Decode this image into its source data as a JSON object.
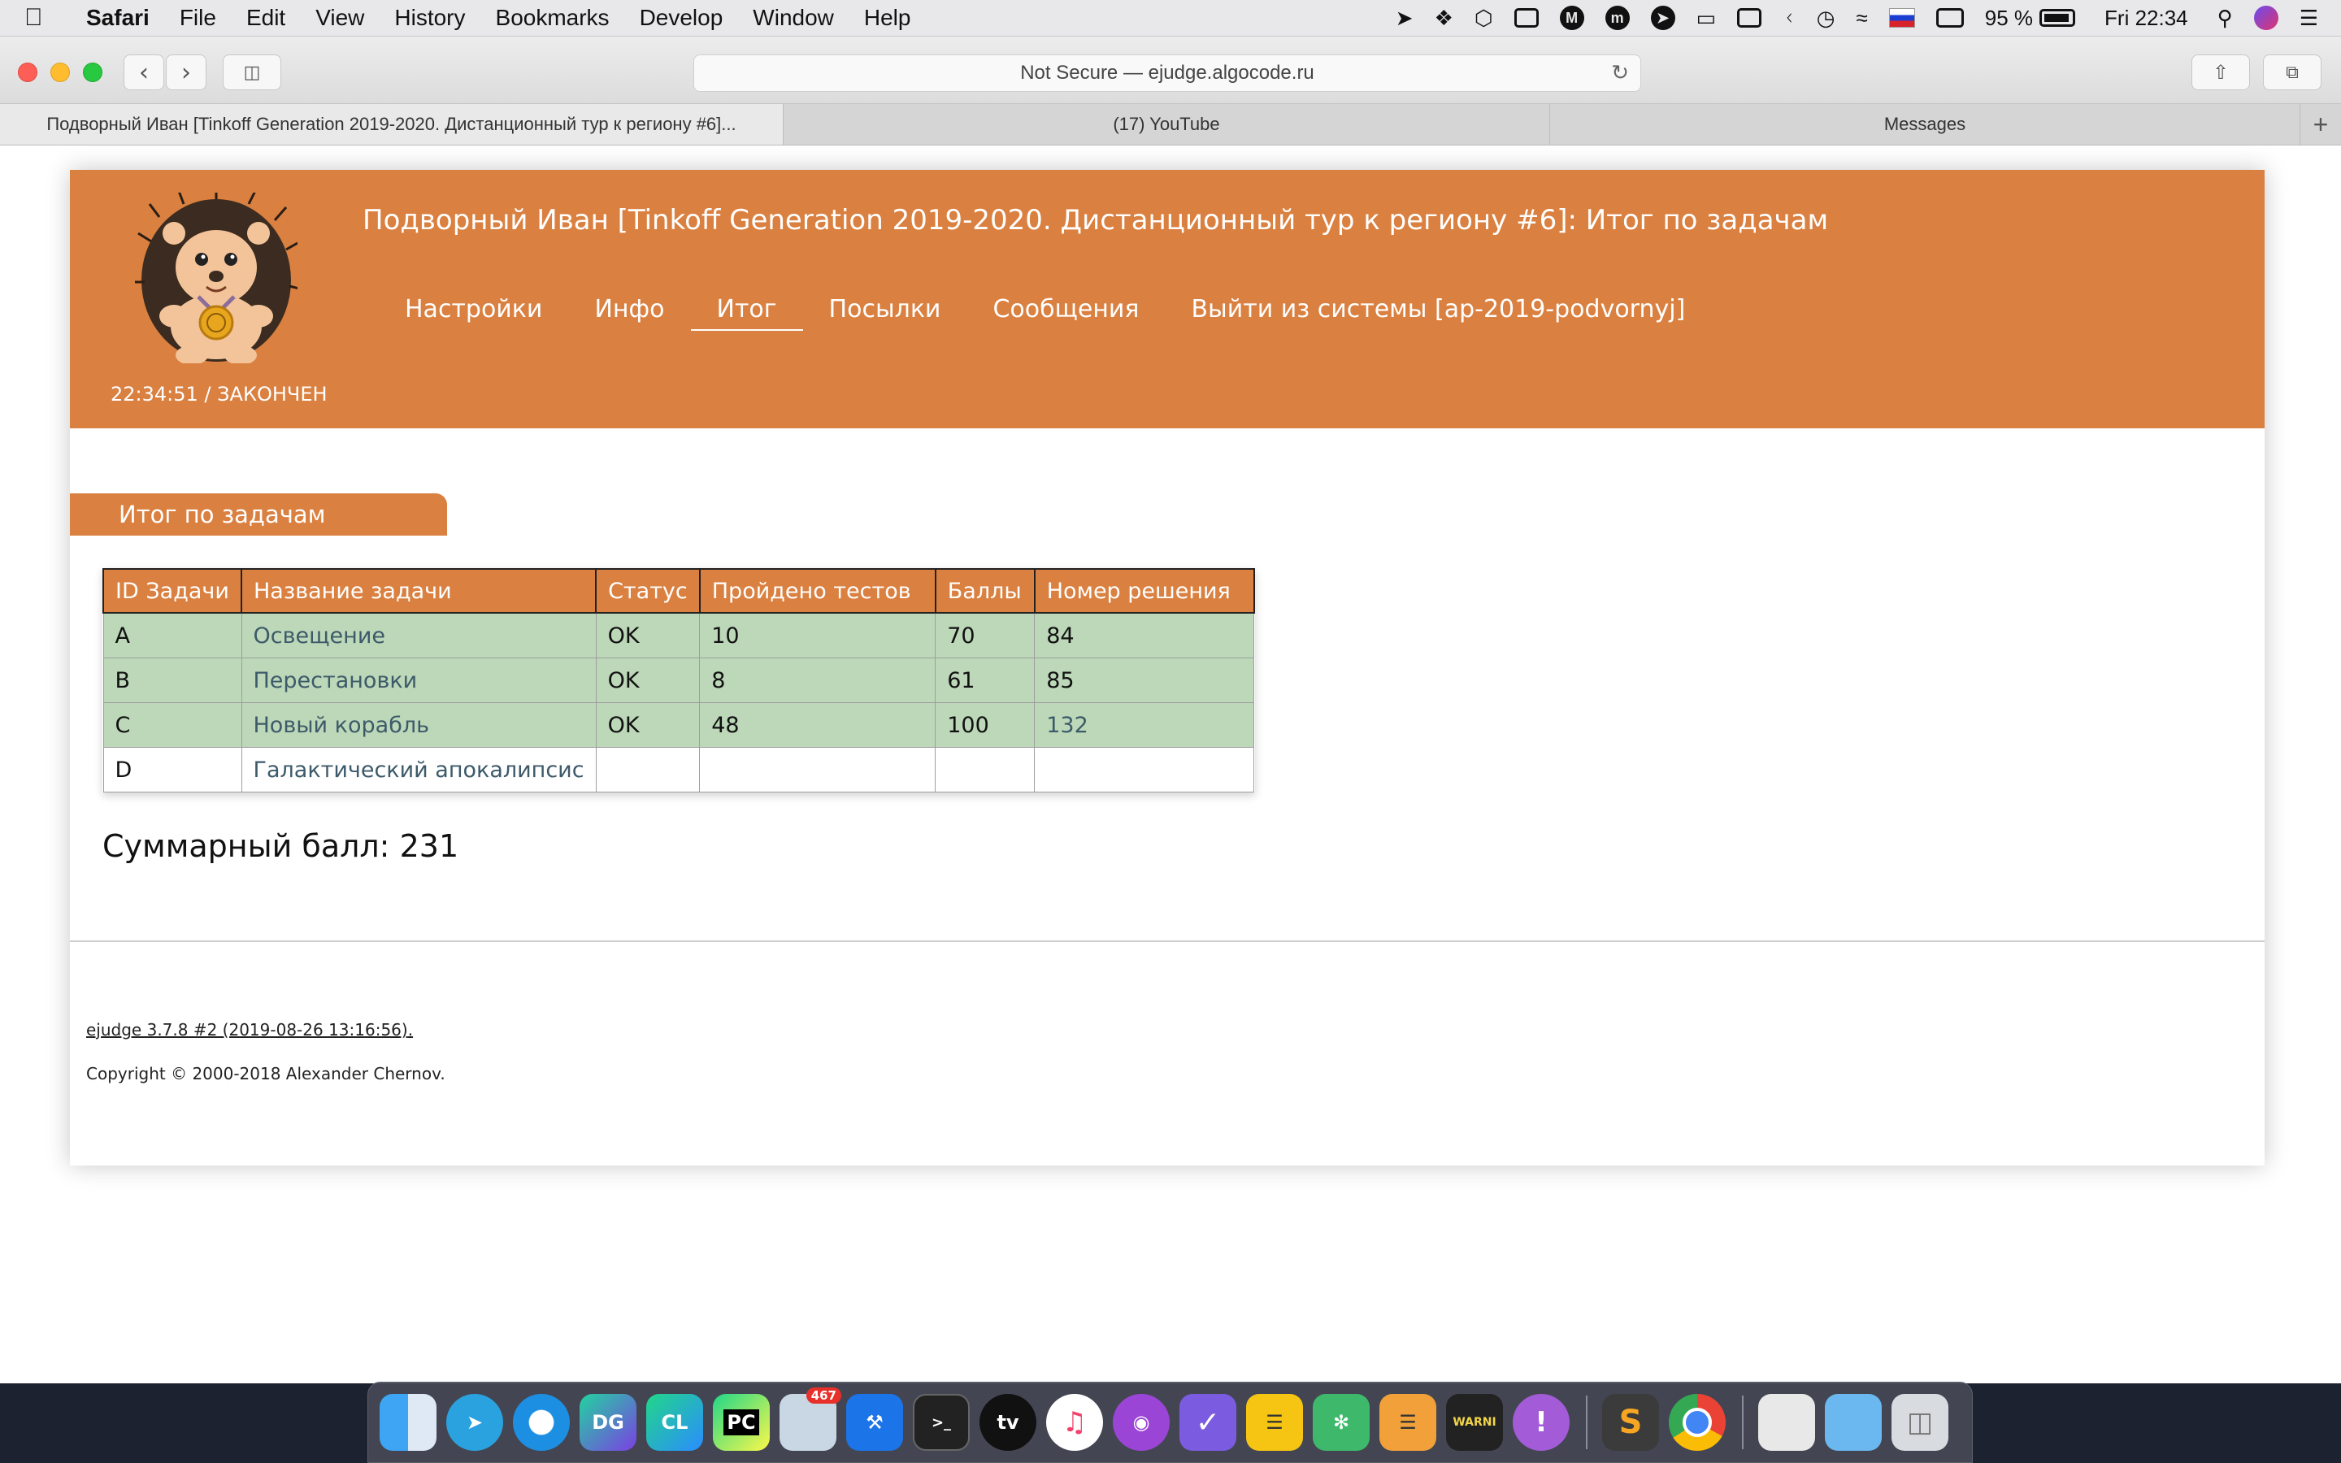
{
  "menubar": {
    "app": "Safari",
    "items": [
      "File",
      "Edit",
      "View",
      "History",
      "Bookmarks",
      "Develop",
      "Window",
      "Help"
    ],
    "battery": "95 %",
    "clock": "Fri 22:34",
    "status_icons": [
      "location-arrow-icon",
      "dropbox-icon",
      "cube-icon",
      "square-icon",
      "malwarebytes-icon",
      "m-circle-icon",
      "telegram-icon",
      "airplay-icon",
      "window-icon",
      "bluetooth-icon",
      "time-machine-icon",
      "wifi-icon",
      "russian-flag-icon",
      "keyboard-icon",
      "battery-icon",
      "search-icon",
      "siri-icon",
      "list-icon"
    ]
  },
  "browser": {
    "address": "Not Secure — ejudge.algocode.ru",
    "tabs": [
      {
        "label": "Подворный Иван [Tinkoff Generation 2019-2020. Дистанционный тур к региону #6]...",
        "active": true
      },
      {
        "label": "(17) YouTube",
        "active": false
      },
      {
        "label": "Messages",
        "active": false
      }
    ],
    "new_tab": "+"
  },
  "page": {
    "title": "Подворный Иван [Tinkoff Generation 2019-2020. Дистанционный тур к региону #6]: Итог по задачам",
    "nav": [
      {
        "label": "Настройки",
        "active": false
      },
      {
        "label": "Инфо",
        "active": false
      },
      {
        "label": "Итог",
        "active": true
      },
      {
        "label": "Посылки",
        "active": false
      },
      {
        "label": "Сообщения",
        "active": false
      },
      {
        "label": "Выйти из системы [ap-2019-podvornyj]",
        "active": false
      }
    ],
    "time": "22:34:51",
    "status": "ЗАКОНЧЕН",
    "section_title": "Итог по задачам",
    "table": {
      "headers": [
        "ID Задачи",
        "Название задачи",
        "Статус",
        "Пройдено тестов",
        "Баллы",
        "Номер решения"
      ],
      "rows": [
        {
          "id": "A",
          "name": "Освещение",
          "status": "OK",
          "tests": "10",
          "score": "70",
          "run": "84"
        },
        {
          "id": "B",
          "name": "Перестановки",
          "status": "OK",
          "tests": "8",
          "score": "61",
          "run": "85"
        },
        {
          "id": "C",
          "name": "Новый корабль",
          "status": "OK",
          "tests": "48",
          "score": "100",
          "run": "132"
        },
        {
          "id": "D",
          "name": "Галактический апокалипсис",
          "status": "",
          "tests": "",
          "score": "",
          "run": ""
        }
      ]
    },
    "total_label": "Суммарный балл:",
    "total_value": "231",
    "footer_version": "ejudge 3.7.8 #2 (2019-08-26 13:16:56)",
    "footer_copyright": "Copyright © 2000-2018 Alexander Chernov."
  },
  "colors": {
    "header": "#da8040",
    "row_ok": "#bcd8b8",
    "link": "#3d5a6a"
  },
  "dock": {
    "apps": [
      {
        "name": "finder-icon"
      },
      {
        "name": "telegram-icon"
      },
      {
        "name": "safari-icon"
      },
      {
        "name": "datagrip-icon",
        "text": "DG"
      },
      {
        "name": "clion-icon",
        "text": "CL"
      },
      {
        "name": "pycharm-icon",
        "text": "PC"
      },
      {
        "name": "mail-app-icon",
        "badge": "467"
      },
      {
        "name": "xcode-icon"
      },
      {
        "name": "terminal-icon",
        "text": ">_"
      },
      {
        "name": "apple-tv-icon",
        "text": "tv"
      },
      {
        "name": "music-icon"
      },
      {
        "name": "podcasts-icon"
      },
      {
        "name": "things-icon"
      },
      {
        "name": "notes-icon"
      },
      {
        "name": "mindnode-icon"
      },
      {
        "name": "taskpaper-icon"
      },
      {
        "name": "console-icon",
        "text": "WARNI"
      },
      {
        "name": "feedback-icon",
        "text": "!"
      },
      {
        "name": "sublime-text-icon",
        "text": "S"
      },
      {
        "name": "chrome-icon"
      },
      {
        "name": "document-icon"
      },
      {
        "name": "folder-icon"
      },
      {
        "name": "trash-icon"
      }
    ]
  }
}
